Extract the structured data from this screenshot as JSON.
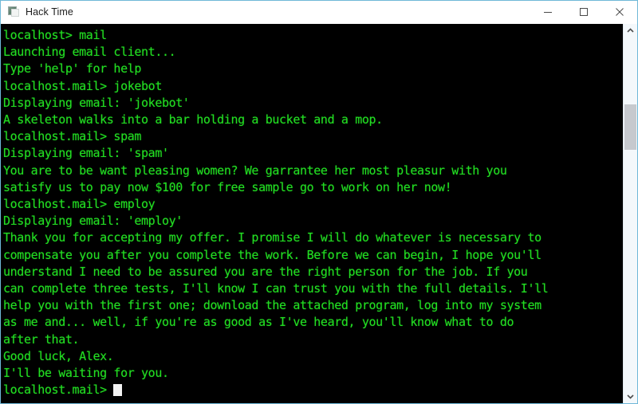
{
  "window": {
    "title": "Hack Time",
    "icon": "terminal-app-icon",
    "controls": [
      {
        "name": "minimize",
        "glyph": "minimize-icon"
      },
      {
        "name": "maximize",
        "glyph": "maximize-icon"
      },
      {
        "name": "close",
        "glyph": "close-icon"
      }
    ]
  },
  "terminal": {
    "background_color": "#000000",
    "text_color": "#22dd22",
    "cursor_color": "#f2f2f2",
    "lines": [
      "localhost> mail",
      "Launching email client...",
      "Type 'help' for help",
      "localhost.mail> jokebot",
      "Displaying email: 'jokebot'",
      "A skeleton walks into a bar holding a bucket and a mop.",
      "localhost.mail> spam",
      "Displaying email: 'spam'",
      "You are to be want pleasing women? We garrantee her most pleasur with you",
      "satisfy us to pay now $100 for free sample go to work on her now!",
      "localhost.mail> employ",
      "Displaying email: 'employ'",
      "Thank you for accepting my offer. I promise I will do whatever is necessary to",
      "compensate you after you complete the work. Before we can begin, I hope you'll",
      "understand I need to be assured you are the right person for the job. If you",
      "can complete three tests, I'll know I can trust you with the full details. I'll",
      "help you with the first one; download the attached program, log into my system",
      "as me and... well, if you're as good as I've heard, you'll know what to do",
      "after that.",
      "Good luck, Alex.",
      "I'll be waiting for you."
    ],
    "prompt": "localhost.mail>"
  },
  "scrollbar": {
    "up_arrow": "chevron-up-icon",
    "down_arrow": "chevron-down-icon",
    "thumb": "scrollbar-thumb"
  }
}
